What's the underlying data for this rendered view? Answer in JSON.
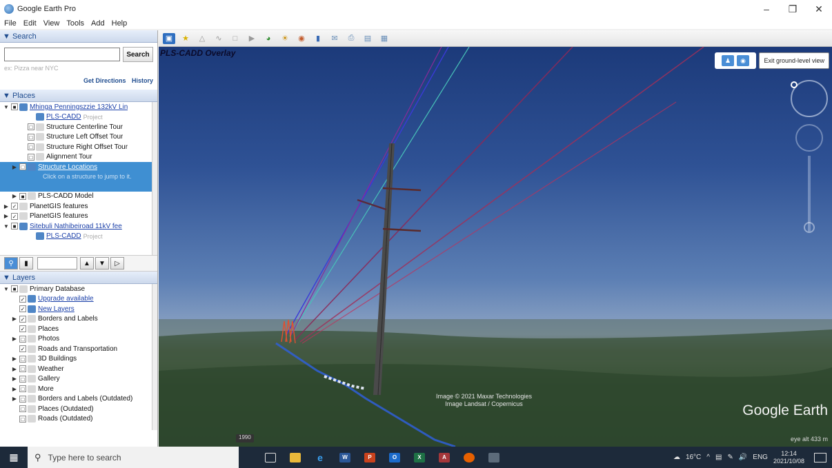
{
  "window": {
    "title": "Google Earth Pro",
    "controls": [
      "–",
      "❐",
      "✕"
    ]
  },
  "menu": [
    "File",
    "Edit",
    "View",
    "Tools",
    "Add",
    "Help"
  ],
  "search": {
    "header": "▼ Search",
    "placeholder": "",
    "button": "Search",
    "hint": "ex: Pizza near NYC",
    "get_directions": "Get Directions",
    "history": "History"
  },
  "places": {
    "header": "▼ Places",
    "items": [
      {
        "label": "Mhinga Penningszzie 132kV Lin",
        "sub": "",
        "link": true,
        "depth": 0,
        "exp": "▼",
        "chk": "■"
      },
      {
        "label": "PLS-CADD",
        "sub": "Project",
        "link": true,
        "depth": 2,
        "exp": "",
        "chk": ""
      },
      {
        "label": "Structure Centerline Tour",
        "sub": "",
        "link": false,
        "depth": 2,
        "exp": "",
        "chk": "□"
      },
      {
        "label": "Structure Left Offset Tour",
        "sub": "",
        "link": false,
        "depth": 2,
        "exp": "",
        "chk": "□"
      },
      {
        "label": "Structure Right Offset Tour",
        "sub": "",
        "link": false,
        "depth": 2,
        "exp": "",
        "chk": "□"
      },
      {
        "label": "Alignment Tour",
        "sub": "",
        "link": false,
        "depth": 2,
        "exp": "",
        "chk": "□"
      },
      {
        "label": "Structure Locations",
        "sub": "",
        "link": true,
        "depth": 1,
        "exp": "▶",
        "chk": "□",
        "selected": true
      },
      {
        "label": "PLS-CADD Model",
        "sub": "",
        "link": false,
        "depth": 1,
        "exp": "▶",
        "chk": "■"
      },
      {
        "label": "PlanetGIS features",
        "sub": "",
        "link": false,
        "depth": 0,
        "exp": "▶",
        "chk": "✓"
      },
      {
        "label": "PlanetGIS features",
        "sub": "",
        "link": false,
        "depth": 0,
        "exp": "▶",
        "chk": "✓"
      },
      {
        "label": "Sitebuli Nathibeiroad 11kV fee",
        "sub": "",
        "link": true,
        "depth": 0,
        "exp": "▼",
        "chk": "■"
      },
      {
        "label": "PLS-CADD",
        "sub": "Project",
        "link": true,
        "depth": 2,
        "exp": "",
        "chk": ""
      }
    ],
    "selected_hint": "Click on a structure to jump to it."
  },
  "layers": {
    "header": "▼ Layers",
    "items": [
      {
        "label": "Primary Database",
        "link": false,
        "depth": 0,
        "exp": "▼",
        "chk": "■"
      },
      {
        "label": "Upgrade available",
        "link": true,
        "depth": 1,
        "exp": "",
        "chk": "✓"
      },
      {
        "label": "New Layers",
        "link": true,
        "depth": 1,
        "exp": "",
        "chk": "✓"
      },
      {
        "label": "Borders and Labels",
        "link": false,
        "depth": 1,
        "exp": "▶",
        "chk": "✓"
      },
      {
        "label": "Places",
        "link": false,
        "depth": 1,
        "exp": "",
        "chk": "✓"
      },
      {
        "label": "Photos",
        "link": false,
        "depth": 1,
        "exp": "▶",
        "chk": "□"
      },
      {
        "label": "Roads and Transportation",
        "link": false,
        "depth": 1,
        "exp": "",
        "chk": "✓"
      },
      {
        "label": "3D Buildings",
        "link": false,
        "depth": 1,
        "exp": "▶",
        "chk": "□"
      },
      {
        "label": "Weather",
        "link": false,
        "depth": 1,
        "exp": "▶",
        "chk": "□"
      },
      {
        "label": "Gallery",
        "link": false,
        "depth": 1,
        "exp": "▶",
        "chk": "□"
      },
      {
        "label": "More",
        "link": false,
        "depth": 1,
        "exp": "▶",
        "chk": "□"
      },
      {
        "label": "Borders and Labels (Outdated)",
        "link": false,
        "depth": 1,
        "exp": "▶",
        "chk": "□"
      },
      {
        "label": "Places (Outdated)",
        "link": false,
        "depth": 1,
        "exp": "",
        "chk": "□"
      },
      {
        "label": "Roads (Outdated)",
        "link": false,
        "depth": 1,
        "exp": "",
        "chk": "□"
      }
    ]
  },
  "map": {
    "overlay_title": "PLS-CADD Overlay",
    "exit_button": "Exit ground-level view",
    "credit_line1": "Image © 2021 Maxar Technologies",
    "credit_line2": "Image Landsat / Copernicus",
    "brand": "Google Earth",
    "eye_alt": "eye alt  433 m",
    "scale": "1990"
  },
  "taskbar": {
    "search_placeholder": "Type here to search",
    "temperature": "16°C",
    "language": "ENG",
    "time": "12:14",
    "date": "2021/10/08"
  }
}
